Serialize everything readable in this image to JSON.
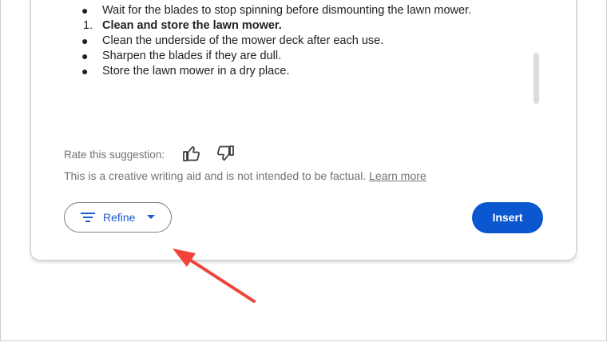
{
  "list": [
    {
      "marker": "●",
      "type": "bullet",
      "text": "Wait for the blades to stop spinning before dismounting the lawn mower."
    },
    {
      "marker": "1.",
      "type": "numbered",
      "text": "Clean and store the lawn mower."
    },
    {
      "marker": "●",
      "type": "bullet",
      "text": "Clean the underside of the mower deck after each use."
    },
    {
      "marker": "●",
      "type": "bullet",
      "text": "Sharpen the blades if they are dull."
    },
    {
      "marker": "●",
      "type": "bullet",
      "text": "Store the lawn mower in a dry place."
    }
  ],
  "feedback": {
    "rate_label": "Rate this suggestion:",
    "thumbs_up_icon": "thumbs-up-icon",
    "thumbs_down_icon": "thumbs-down-icon"
  },
  "disclaimer": {
    "text": "This is a creative writing aid and is not intended to be factual.",
    "link": "Learn more"
  },
  "actions": {
    "refine_label": "Refine",
    "insert_label": "Insert"
  },
  "colors": {
    "primary": "#0b57d0",
    "annotation_arrow": "#f0443a"
  }
}
